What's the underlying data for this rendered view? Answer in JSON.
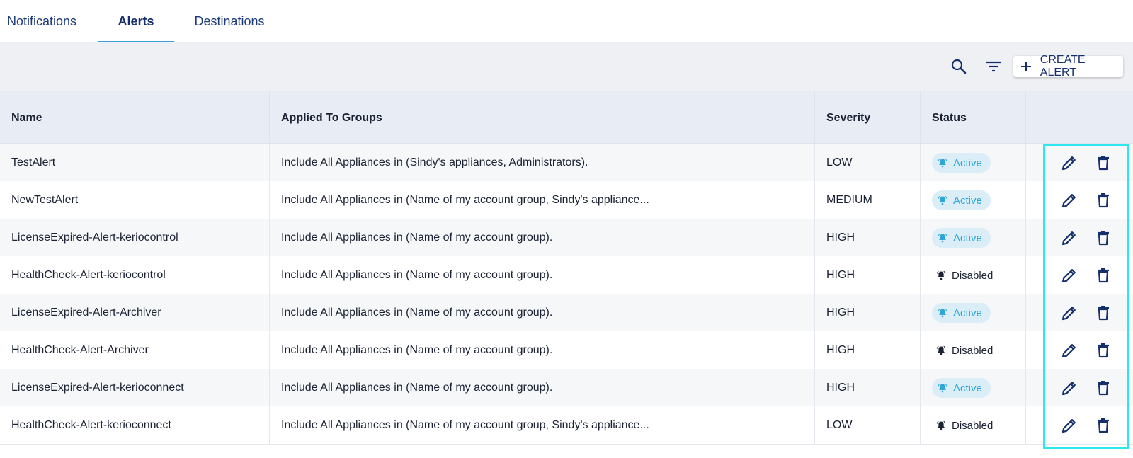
{
  "tabs": [
    {
      "label": "Notifications",
      "active": false
    },
    {
      "label": "Alerts",
      "active": true
    },
    {
      "label": "Destinations",
      "active": false
    }
  ],
  "toolbar": {
    "search_icon": "search-icon",
    "filter_icon": "filter-icon",
    "create_label": "CREATE ALERT"
  },
  "table": {
    "columns": [
      "Name",
      "Applied To Groups",
      "Severity",
      "Status",
      ""
    ],
    "rows": [
      {
        "name": "TestAlert",
        "groups": "Include All Appliances in (Sindy's appliances, Administrators).",
        "severity": "LOW",
        "status": "Active"
      },
      {
        "name": "NewTestAlert",
        "groups": "Include All Appliances in (Name of my account group, Sindy's appliance...",
        "severity": "MEDIUM",
        "status": "Active"
      },
      {
        "name": "LicenseExpired-Alert-keriocontrol",
        "groups": "Include All Appliances in (Name of my account group).",
        "severity": "HIGH",
        "status": "Active"
      },
      {
        "name": "HealthCheck-Alert-keriocontrol",
        "groups": "Include All Appliances in (Name of my account group).",
        "severity": "HIGH",
        "status": "Disabled"
      },
      {
        "name": "LicenseExpired-Alert-Archiver",
        "groups": "Include All Appliances in (Name of my account group).",
        "severity": "HIGH",
        "status": "Active"
      },
      {
        "name": "HealthCheck-Alert-Archiver",
        "groups": "Include All Appliances in (Name of my account group).",
        "severity": "HIGH",
        "status": "Disabled"
      },
      {
        "name": "LicenseExpired-Alert-kerioconnect",
        "groups": "Include All Appliances in (Name of my account group).",
        "severity": "HIGH",
        "status": "Active"
      },
      {
        "name": "HealthCheck-Alert-kerioconnect",
        "groups": "Include All Appliances in (Name of my account group, Sindy's appliance...",
        "severity": "LOW",
        "status": "Disabled"
      }
    ]
  },
  "colors": {
    "accent": "#3aa0e0",
    "active_text": "#2fa6d6",
    "active_bg": "#dbeef7",
    "navy": "#15306b",
    "highlight": "#2ee6f0"
  }
}
